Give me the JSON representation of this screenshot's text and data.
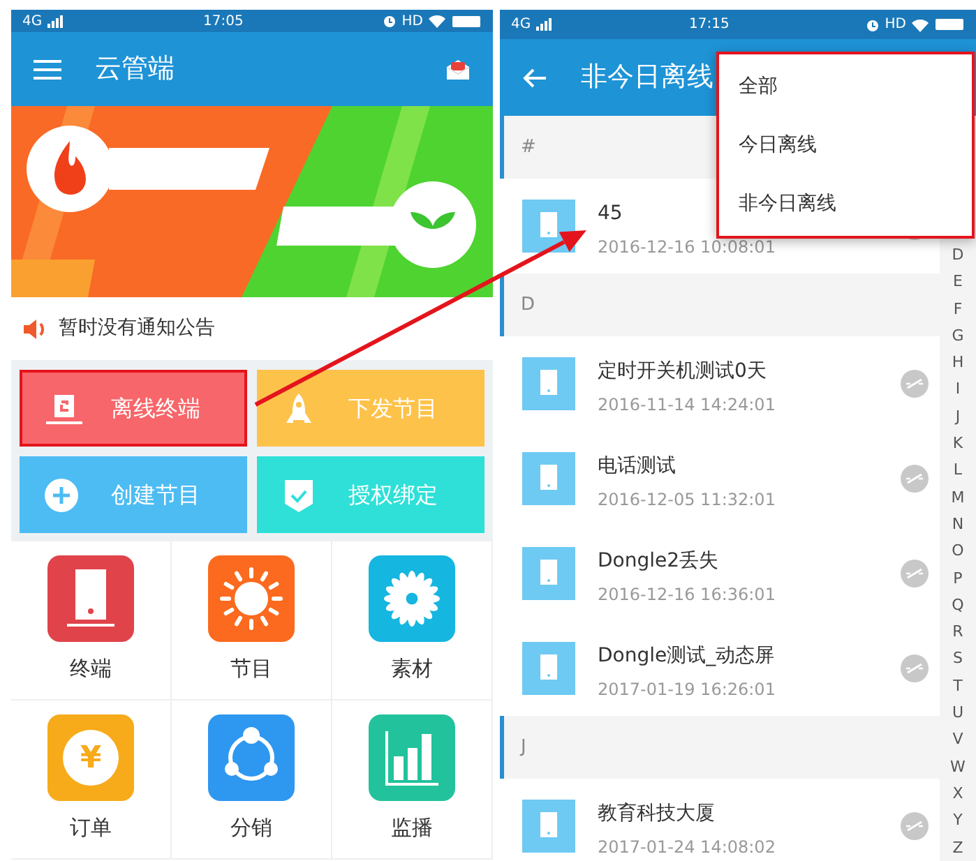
{
  "home_screen": {
    "status_bar": {
      "network": "4G",
      "time": "17:05",
      "hd": "HD"
    },
    "app_bar": {
      "title": "云管端"
    },
    "notice": "暂时没有通知公告",
    "tiles": [
      {
        "label": "离线终端",
        "kind": "terminal",
        "color": "#f7666a",
        "highlighted": true
      },
      {
        "label": "下发节目",
        "kind": "rocket",
        "color": "#fdc24a",
        "highlighted": false
      },
      {
        "label": "创建节目",
        "kind": "plus",
        "color": "#4cbcf3",
        "highlighted": false
      },
      {
        "label": "授权绑定",
        "kind": "shield",
        "color": "#2ee0d8",
        "highlighted": false
      }
    ],
    "grid": [
      {
        "label": "终端",
        "kind": "device",
        "color": "#e0434a"
      },
      {
        "label": "节目",
        "kind": "sun",
        "color": "#fb6a1e"
      },
      {
        "label": "素材",
        "kind": "flower",
        "color": "#15b6e0"
      },
      {
        "label": "订单",
        "kind": "coin",
        "color": "#f7ab1a",
        "glyph": "¥"
      },
      {
        "label": "分销",
        "kind": "share",
        "color": "#2e97f0"
      },
      {
        "label": "监播",
        "kind": "chart",
        "color": "#22c29c"
      }
    ]
  },
  "offline_screen": {
    "status_bar": {
      "network": "4G",
      "time": "17:15",
      "hd": "HD"
    },
    "app_bar": {
      "title": "非今日离线"
    },
    "sections": [
      {
        "header": "#",
        "items": [
          {
            "name": "45",
            "time": "2016-12-16 10:08:01"
          }
        ]
      },
      {
        "header": "D",
        "items": [
          {
            "name": "定时开关机测试0天",
            "time": "2016-11-14 14:24:01"
          },
          {
            "name": "电话测试",
            "time": "2016-12-05 11:32:01"
          },
          {
            "name": "Dongle2丢失",
            "time": "2016-12-16 16:36:01"
          },
          {
            "name": "Dongle测试_动态屏",
            "time": "2017-01-19 16:26:01"
          }
        ]
      },
      {
        "header": "J",
        "items": [
          {
            "name": "教育科技大厦",
            "time": "2017-01-24 14:08:02"
          }
        ]
      }
    ],
    "index_letters": [
      "D",
      "E",
      "F",
      "G",
      "H",
      "I",
      "J",
      "K",
      "L",
      "M",
      "N",
      "O",
      "P",
      "Q",
      "R",
      "S",
      "T",
      "U",
      "V",
      "W",
      "X",
      "Y",
      "Z"
    ],
    "menu": {
      "highlighted": true,
      "items": [
        {
          "label": "全部"
        },
        {
          "label": "今日离线"
        },
        {
          "label": "非今日离线"
        }
      ]
    }
  }
}
